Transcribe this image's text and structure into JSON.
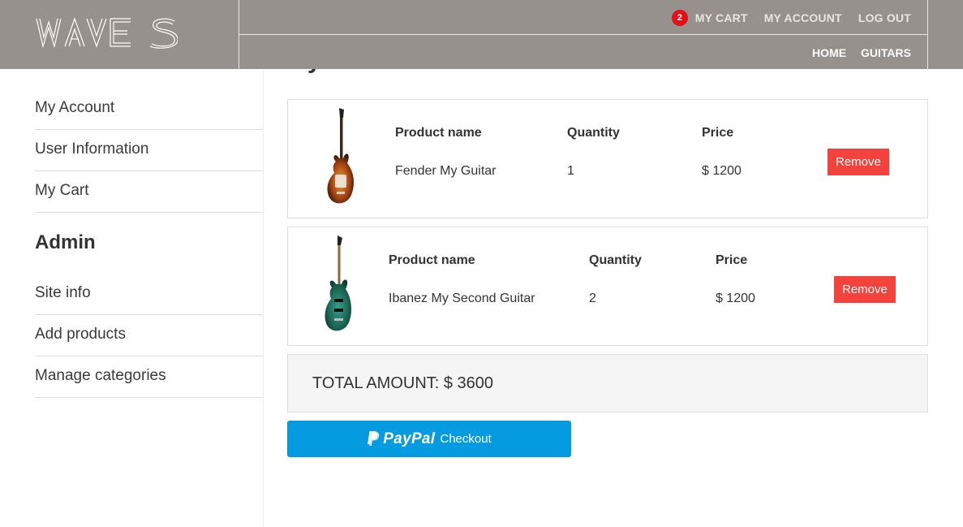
{
  "brand": {
    "logo_text": "WAVES",
    "header_bg": "#96918c"
  },
  "header": {
    "cart_count": "2",
    "top_links": [
      "MY CART",
      "MY ACCOUNT",
      "LOG OUT"
    ],
    "bottom_links": [
      "HOME",
      "GUITARS"
    ]
  },
  "sidebar": {
    "user_items": [
      "My Account",
      "User Information",
      "My Cart"
    ],
    "admin_heading": "Admin",
    "admin_items": [
      "Site info",
      "Add products",
      "Manage categories"
    ]
  },
  "main": {
    "title": "My Cart",
    "cart_items": [
      {
        "name_header": "Product name",
        "qty_header": "Quantity",
        "price_header": "Price",
        "name": "Fender My Guitar",
        "quantity": "1",
        "price": "$ 1200",
        "remove_label": "Remove",
        "image_icon": "electric-guitar-sunburst"
      },
      {
        "name_header": "Product name",
        "qty_header": "Quantity",
        "price_header": "Price",
        "name": "Ibanez My Second Guitar",
        "quantity": "2",
        "price": "$ 1200",
        "remove_label": "Remove",
        "image_icon": "electric-guitar-green"
      }
    ],
    "total_text": "TOTAL AMOUNT: $ 3600",
    "paypal": {
      "logo": "PayPal",
      "label": "Checkout",
      "color": "#049be0"
    },
    "remove_color": "#f4423d",
    "badge_color": "#e41017"
  }
}
